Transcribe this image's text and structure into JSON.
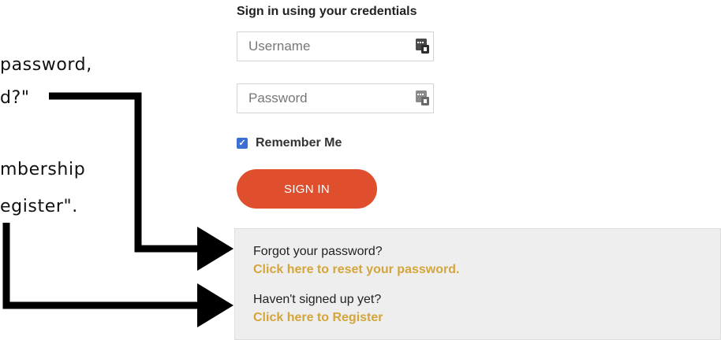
{
  "colors": {
    "accent": "#df4f2e",
    "link": "#d4a53b",
    "checkbox": "#3b6fd4",
    "panel": "#eeeeee",
    "arrow": "#000000"
  },
  "callouts": {
    "forgot_line1": "password,",
    "forgot_line2": "d?\"",
    "register_line1": "mbership",
    "register_line2": "egister\"."
  },
  "login": {
    "title": "Sign in using your credentials",
    "username": {
      "placeholder": "Username",
      "value": "",
      "icon": "key-icon"
    },
    "password": {
      "placeholder": "Password",
      "value": "",
      "icon": "key-icon"
    },
    "remember_label": "Remember Me",
    "remember_checked": true,
    "signin_label": "SIGN IN"
  },
  "help": {
    "forgot_question": "Forgot your password?",
    "forgot_link": "Click here to reset your password.",
    "signup_question": "Haven't signed up yet?",
    "signup_link": "Click here to Register"
  }
}
